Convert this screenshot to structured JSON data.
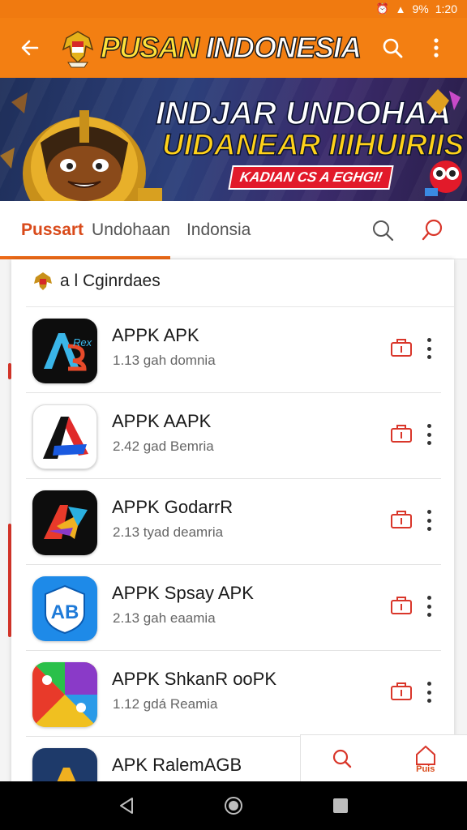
{
  "status_bar": {
    "battery_text": "9%",
    "time": "1:20"
  },
  "app_bar": {
    "title_part1": "PUSAN",
    "title_part2": " INDONESIA"
  },
  "banner": {
    "headline1": "INDJAR UNDOHAA",
    "headline2": "UIDANEAR IIIHUIRIIS",
    "subtag": "KADIAN CS A EGHGI!"
  },
  "tabs": {
    "active": "Pussart",
    "second": "Undohaan",
    "third": "Indonsia"
  },
  "section": {
    "title": "a l Cginrdaes"
  },
  "apps": [
    {
      "name": "APPK APK",
      "meta": "1.13 gah domnia"
    },
    {
      "name": "APPK AAPK",
      "meta": "2.42 gad Bemria"
    },
    {
      "name": "APPK GodarrR",
      "meta": "2.13 tyad deamria"
    },
    {
      "name": "APPK Spsay APK",
      "meta": "2.13 gah eaamia"
    },
    {
      "name": "APPK ShkanR ooPK",
      "meta": "1.12 gdá Reamia"
    },
    {
      "name": "APK RalemAGB",
      "meta": ""
    }
  ],
  "app_icon_text": {
    "app1": "Rex",
    "app4": "AB"
  },
  "bottom_tabs": {
    "home_label": "Puis"
  },
  "colors": {
    "accent": "#f37f12",
    "active_tab": "#d94a1a",
    "action_red": "#d9362a"
  }
}
